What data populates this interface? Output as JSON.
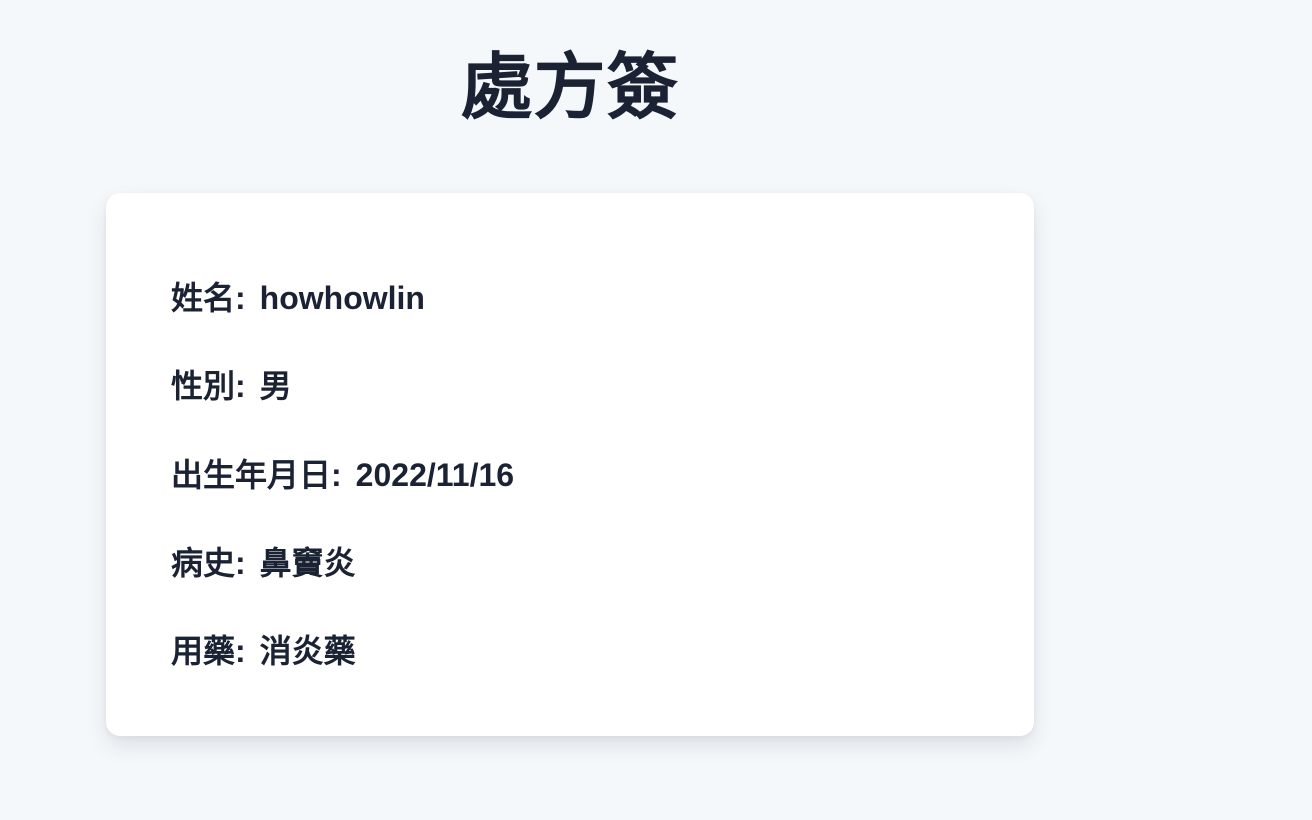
{
  "page": {
    "title": "處方簽"
  },
  "prescription": {
    "fields": [
      {
        "label": "姓名:",
        "value": "howhowlin"
      },
      {
        "label": "性別:",
        "value": "男"
      },
      {
        "label": "出生年月日:",
        "value": "2022/11/16"
      },
      {
        "label": "病史:",
        "value": "鼻竇炎"
      },
      {
        "label": "用藥:",
        "value": "消炎藥"
      }
    ]
  },
  "colors": {
    "background": "#f5f8fb",
    "card": "#ffffff",
    "text": "#1a2233"
  }
}
